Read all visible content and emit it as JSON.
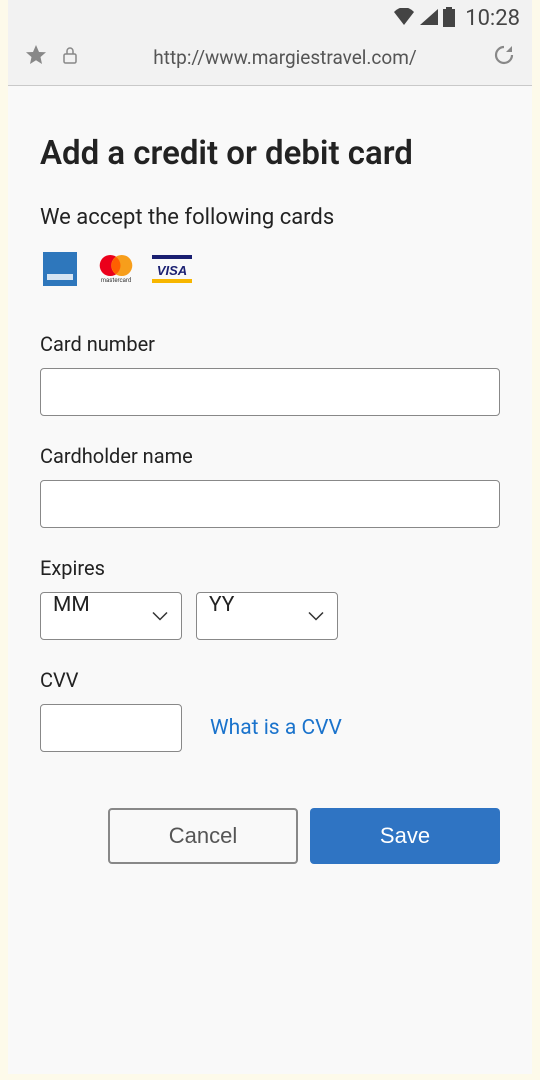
{
  "status_bar": {
    "time": "10:28"
  },
  "toolbar": {
    "url": "http://www.margiestravel.com/"
  },
  "page": {
    "title": "Add a credit or debit card",
    "subtitle": "We accept the following cards",
    "cards": {
      "amex": "amex",
      "mastercard": "mastercard",
      "visa": "VISA"
    }
  },
  "form": {
    "card_number": {
      "label": "Card number",
      "value": ""
    },
    "cardholder_name": {
      "label": "Cardholder name",
      "value": ""
    },
    "expires": {
      "label": "Expires",
      "month_placeholder": "MM",
      "year_placeholder": "YY"
    },
    "cvv": {
      "label": "CVV",
      "value": "",
      "help_link": "What is a CVV"
    }
  },
  "buttons": {
    "cancel": "Cancel",
    "save": "Save"
  }
}
